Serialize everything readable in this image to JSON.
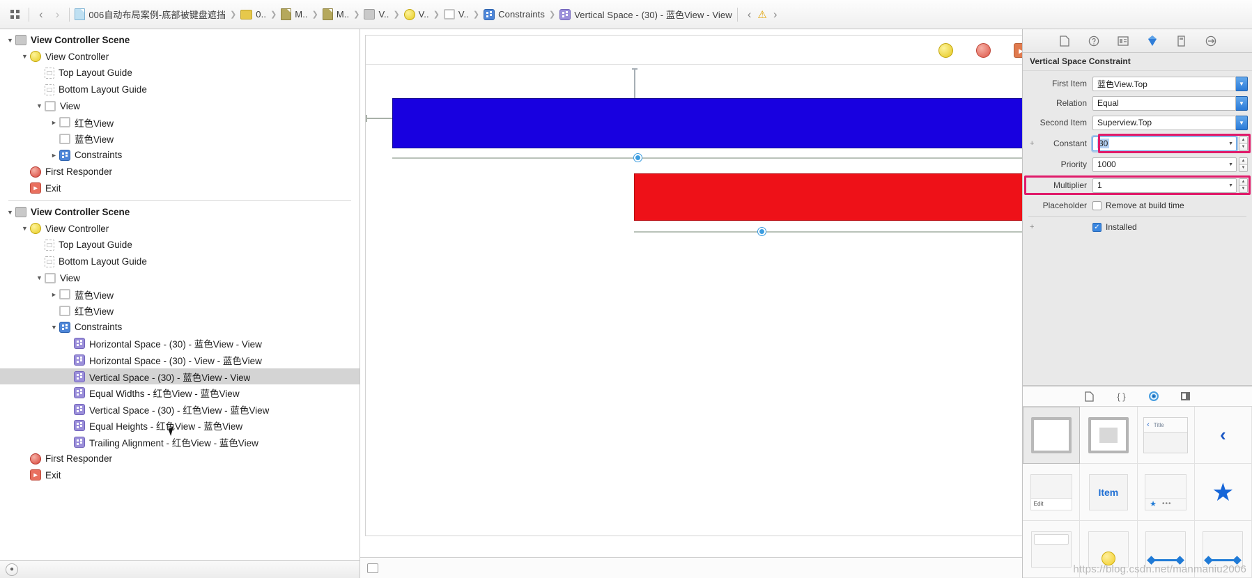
{
  "jumpbar": {
    "related_items_icon": "grid-icon",
    "back_label": "‹",
    "forward_label": "›",
    "crumbs": [
      {
        "icon": "storyboard-file-icon",
        "label": "006自动布局案例-底部被键盘遮挡"
      },
      {
        "icon": "folder-icon",
        "label": "0.."
      },
      {
        "icon": "document-icon",
        "label": "M.."
      },
      {
        "icon": "document-icon",
        "label": "M.."
      },
      {
        "icon": "scene-icon",
        "label": "V.."
      },
      {
        "icon": "view-controller-icon",
        "label": "V.."
      },
      {
        "icon": "view-icon",
        "label": "V.."
      },
      {
        "icon": "constraints-icon",
        "label": "Constraints"
      },
      {
        "icon": "constraint-icon",
        "label": "Vertical Space - (30) - 蓝色View - View"
      }
    ],
    "nav_back": "‹",
    "warning_icon": "warning-triangle-icon",
    "nav_forward": "›"
  },
  "outline": {
    "scene1": {
      "title": "View Controller Scene",
      "items": [
        {
          "label": "View Controller",
          "icon": "view-controller-icon",
          "indent": 1,
          "twisty": "down"
        },
        {
          "label": "Top Layout Guide",
          "icon": "layout-guide-icon",
          "indent": 2,
          "twisty": ""
        },
        {
          "label": "Bottom Layout Guide",
          "icon": "layout-guide-icon",
          "indent": 2,
          "twisty": ""
        },
        {
          "label": "View",
          "icon": "view-icon",
          "indent": 2,
          "twisty": "down"
        },
        {
          "label": "红色View",
          "icon": "view-icon",
          "indent": 3,
          "twisty": "right"
        },
        {
          "label": "蓝色View",
          "icon": "view-icon",
          "indent": 3,
          "twisty": ""
        },
        {
          "label": "Constraints",
          "icon": "constraints-icon",
          "indent": 3,
          "twisty": "right"
        },
        {
          "label": "First Responder",
          "icon": "first-responder-icon",
          "indent": 1,
          "twisty": ""
        },
        {
          "label": "Exit",
          "icon": "exit-icon",
          "indent": 1,
          "twisty": ""
        }
      ]
    },
    "scene2": {
      "title": "View Controller Scene",
      "items": [
        {
          "label": "View Controller",
          "icon": "view-controller-icon",
          "indent": 1,
          "twisty": "down"
        },
        {
          "label": "Top Layout Guide",
          "icon": "layout-guide-icon",
          "indent": 2,
          "twisty": ""
        },
        {
          "label": "Bottom Layout Guide",
          "icon": "layout-guide-icon",
          "indent": 2,
          "twisty": ""
        },
        {
          "label": "View",
          "icon": "view-icon",
          "indent": 2,
          "twisty": "down"
        },
        {
          "label": "蓝色View",
          "icon": "view-icon",
          "indent": 3,
          "twisty": "right"
        },
        {
          "label": "红色View",
          "icon": "view-icon",
          "indent": 3,
          "twisty": ""
        },
        {
          "label": "Constraints",
          "icon": "constraints-icon",
          "indent": 3,
          "twisty": "down"
        },
        {
          "label": "Horizontal Space - (30) - 蓝色View - View",
          "icon": "constraint-icon",
          "indent": 4,
          "twisty": ""
        },
        {
          "label": "Horizontal Space - (30) - View - 蓝色View",
          "icon": "constraint-icon",
          "indent": 4,
          "twisty": ""
        },
        {
          "label": "Vertical Space - (30) - 蓝色View - View",
          "icon": "constraint-icon",
          "indent": 4,
          "twisty": "",
          "selected": true
        },
        {
          "label": "Equal Widths - 红色View - 蓝色View",
          "icon": "constraint-icon",
          "indent": 4,
          "twisty": ""
        },
        {
          "label": "Vertical Space - (30) - 红色View - 蓝色View",
          "icon": "constraint-icon",
          "indent": 4,
          "twisty": ""
        },
        {
          "label": "Equal Heights - 红色View - 蓝色View",
          "icon": "constraint-icon",
          "indent": 4,
          "twisty": ""
        },
        {
          "label": "Trailing Alignment - 红色View - 蓝色View",
          "icon": "constraint-icon",
          "indent": 4,
          "twisty": ""
        },
        {
          "label": "First Responder",
          "icon": "first-responder-icon",
          "indent": 1,
          "twisty": ""
        },
        {
          "label": "Exit",
          "icon": "exit-icon",
          "indent": 1,
          "twisty": ""
        }
      ]
    },
    "footer_button": "filter-button"
  },
  "canvas": {
    "dock": [
      {
        "icon": "view-controller-icon",
        "name": "view-controller-dock-icon"
      },
      {
        "icon": "first-responder-icon",
        "name": "first-responder-dock-icon"
      },
      {
        "icon": "exit-icon",
        "name": "exit-dock-icon",
        "glyph": "►"
      }
    ],
    "blue_view_color": "#1800e0",
    "red_view_color": "#ee1118",
    "blue_view_name": "蓝色View",
    "red_view_name": "红色View"
  },
  "inspector": {
    "tabs": [
      {
        "icon": "file-inspector-icon",
        "glyph": "⬚",
        "active": false
      },
      {
        "icon": "quick-help-inspector-icon",
        "glyph": "?",
        "active": false
      },
      {
        "icon": "identity-inspector-icon",
        "glyph": "▤",
        "active": false
      },
      {
        "icon": "attributes-inspector-icon",
        "glyph": "◆",
        "active": false
      },
      {
        "icon": "size-inspector-icon",
        "glyph": "⬛",
        "active": true
      },
      {
        "icon": "connections-inspector-icon",
        "glyph": "⭘",
        "active": false
      }
    ],
    "title": "Vertical Space Constraint",
    "fields": {
      "first_item_label": "First Item",
      "first_item_value": "蓝色View.Top",
      "relation_label": "Relation",
      "relation_value": "Equal",
      "second_item_label": "Second Item",
      "second_item_value": "Superview.Top",
      "constant_label": "Constant",
      "constant_value": "30",
      "priority_label": "Priority",
      "priority_value": "1000",
      "multiplier_label": "Multiplier",
      "multiplier_value": "1",
      "placeholder_label": "Placeholder",
      "placeholder_checkbox_label": "Remove at build time",
      "placeholder_checked": false,
      "installed_label": "Installed",
      "installed_checked": true
    },
    "highlight_color": "#e01b6a"
  },
  "library": {
    "tabs": [
      {
        "icon": "file-template-library-icon",
        "glyph": "⬚",
        "active": false
      },
      {
        "icon": "code-snippet-library-icon",
        "glyph": "{ }",
        "active": false
      },
      {
        "icon": "object-library-icon",
        "glyph": "◎",
        "active": true
      },
      {
        "icon": "media-library-icon",
        "glyph": "▣",
        "active": false
      }
    ],
    "items": [
      {
        "name": "view-object",
        "kind": "view",
        "selected": true
      },
      {
        "name": "container-view-object",
        "kind": "container"
      },
      {
        "name": "navigation-bar-object",
        "kind": "navbar",
        "title": "Title",
        "back": "‹"
      },
      {
        "name": "navigation-item-object",
        "kind": "back"
      },
      {
        "name": "toolbar-object",
        "kind": "toolbar",
        "label": "Edit"
      },
      {
        "name": "bar-button-item-object",
        "kind": "item",
        "label": "Item"
      },
      {
        "name": "tab-bar-object",
        "kind": "tabbar"
      },
      {
        "name": "tab-bar-item-object",
        "kind": "star"
      },
      {
        "name": "search-bar-object",
        "kind": "searchbar"
      },
      {
        "name": "page-control-object",
        "kind": "pagectl"
      },
      {
        "name": "slider-object",
        "kind": "slider"
      },
      {
        "name": "stepper-object",
        "kind": "slider"
      }
    ]
  },
  "watermark": "https://blog.csdn.net/manmaniu2006"
}
